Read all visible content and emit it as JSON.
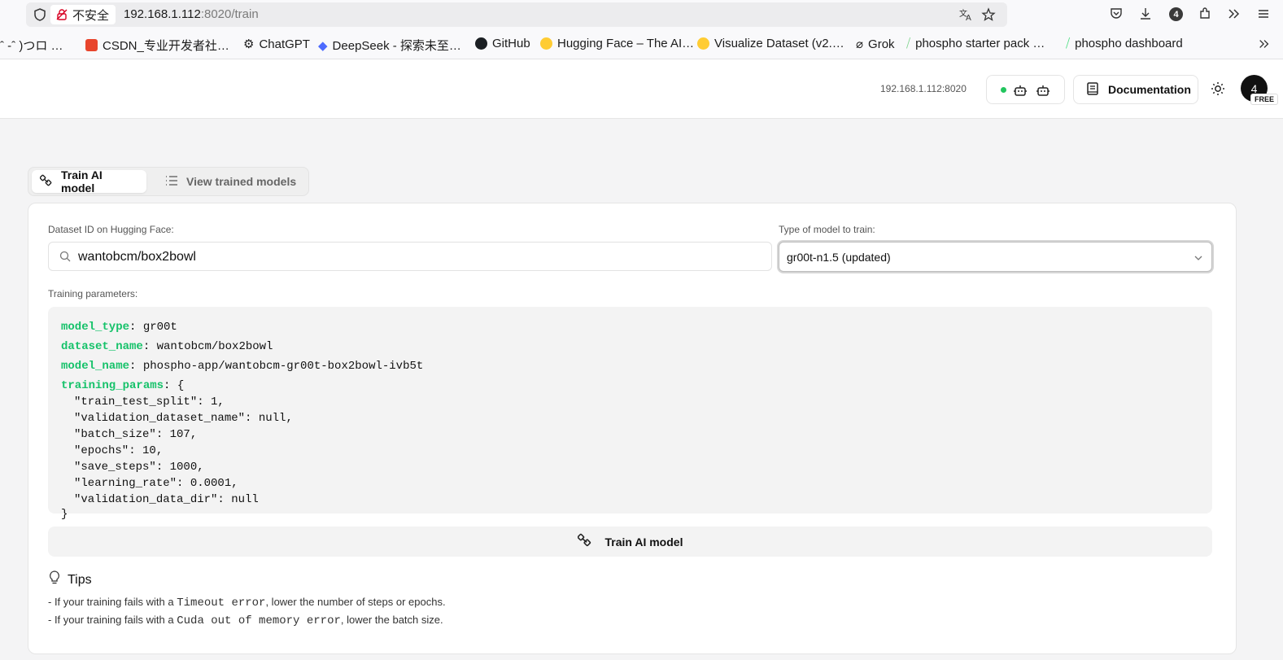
{
  "browser": {
    "insecure_label": "不安全",
    "url_host": "192.168.1.112",
    "url_rest": ":8020/train",
    "extensions_badge": "4",
    "bookmarks": [
      {
        "label": "ˆ -ˆ )つロ …",
        "color": "#bbbbbb"
      },
      {
        "label": "CSDN_专业开发者社…",
        "color": "#e8452c"
      },
      {
        "label": "ChatGPT",
        "color": "#444444"
      },
      {
        "label": "DeepSeek - 探索未至…",
        "color": "#4d6bfe"
      },
      {
        "label": "GitHub",
        "color": "#1b1f23"
      },
      {
        "label": "Hugging Face – The AI…",
        "color": "#ffcc33"
      },
      {
        "label": "Visualize Dataset (v2.…",
        "color": "#ffcc33"
      },
      {
        "label": "Grok",
        "color": "#222222"
      },
      {
        "label": "phospho starter pack …",
        "color": "#7bd389"
      },
      {
        "label": "phospho dashboard",
        "color": "#4ade80"
      }
    ]
  },
  "header": {
    "host": "192.168.1.112:8020",
    "doc_label": "Documentation",
    "avatar_text": "4",
    "plan_badge": "FREE",
    "status_color": "#22c55e"
  },
  "tabs": [
    {
      "label": "Train AI model",
      "active": true
    },
    {
      "label": "View trained models",
      "active": false
    }
  ],
  "form": {
    "dataset_label": "Dataset ID on Hugging Face:",
    "dataset_value": "wantobcm/box2bowl",
    "model_type_label": "Type of model to train:",
    "model_type_value": "gr00t-n1.5 (updated)",
    "params_label": "Training parameters:"
  },
  "params": {
    "model_type_key": "model_type",
    "model_type_val": ": gr00t",
    "dataset_name_key": "dataset_name",
    "dataset_name_val": ": wantobcm/box2bowl",
    "model_name_key": "model_name",
    "model_name_val": ": phospho-app/wantobcm-gr00t-box2bowl-ivb5t",
    "training_params_key": "training_params",
    "training_params_open": ": {",
    "lines": [
      "\"train_test_split\": 1,",
      "\"validation_dataset_name\": null,",
      "\"batch_size\": 107,",
      "\"epochs\": 10,",
      "\"save_steps\": 1000,",
      "\"learning_rate\": 0.0001,",
      "\"validation_data_dir\": null"
    ],
    "close": "}"
  },
  "train_button": "Train AI model",
  "tips": {
    "title": "Tips",
    "tip1_pre": "- If your training fails with a ",
    "tip1_code": "Timeout error",
    "tip1_post": ", lower the number of steps or epochs.",
    "tip2_pre": "- If your training fails with a ",
    "tip2_code": "Cuda out of memory error",
    "tip2_post": ", lower the batch size."
  }
}
